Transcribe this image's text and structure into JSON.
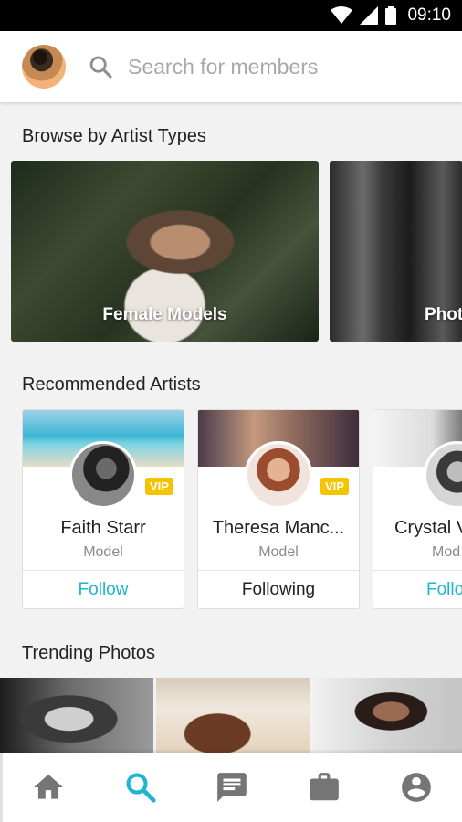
{
  "status_bar": {
    "time": "09:10"
  },
  "header": {
    "search": {
      "placeholder": "Search for members",
      "icon": "search-icon"
    }
  },
  "artist_types": {
    "title": "Browse by Artist Types",
    "items": [
      {
        "label": "Female Models"
      },
      {
        "label": "Phot"
      }
    ]
  },
  "recommended": {
    "title": "Recommended Artists",
    "items": [
      {
        "name": "Faith Starr",
        "role": "Model",
        "badge": "VIP",
        "action": "Follow"
      },
      {
        "name": "Theresa Manc...",
        "role": "Model",
        "badge": "VIP",
        "action": "Following"
      },
      {
        "name": "Crystal V",
        "role": "Mod",
        "action": "Follo"
      }
    ]
  },
  "trending": {
    "title": "Trending Photos"
  },
  "bottom_nav": [
    "home-icon",
    "search-icon",
    "message-icon",
    "briefcase-icon",
    "account-icon"
  ],
  "colors": {
    "accent": "#1eb5d0",
    "vip": "#f5c400"
  }
}
